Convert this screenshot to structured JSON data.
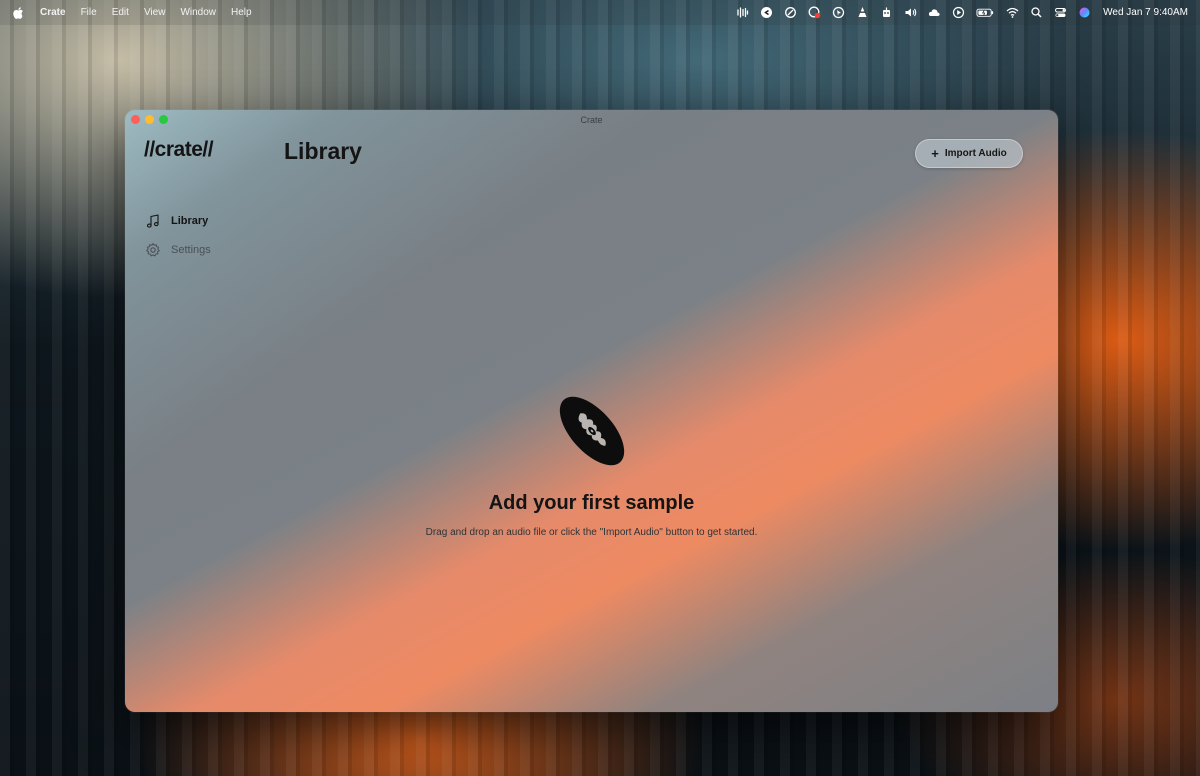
{
  "menubar": {
    "app_name": "Crate",
    "menus": [
      "File",
      "Edit",
      "View",
      "Window",
      "Help"
    ],
    "status_icons": [
      "waveform-icon",
      "clipboard-app-icon",
      "sync-icon",
      "recording-icon",
      "cursor-app-icon",
      "cone-icon",
      "robot-icon",
      "volume-icon",
      "cloud-icon",
      "play-icon",
      "battery-icon",
      "wifi-icon",
      "search-icon",
      "control-center-icon",
      "siri-icon"
    ],
    "clock": "Wed Jan 7  9:40AM"
  },
  "window": {
    "title": "Crate",
    "logo": "//crate//",
    "page_title": "Library",
    "import_button": {
      "icon": "plus-icon",
      "label": "Import Audio"
    }
  },
  "sidebar": {
    "items": [
      {
        "label": "Library",
        "icon": "music-note-icon",
        "active": true
      },
      {
        "label": "Settings",
        "icon": "gear-icon",
        "active": false
      }
    ]
  },
  "empty_state": {
    "icon": "vinyl-record-icon",
    "title": "Add your first sample",
    "subtitle": "Drag and drop an audio file or click the \"Import Audio\" button to get started."
  },
  "colors": {
    "accent_orange": "#ee8a62",
    "window_gray": "#7b8186",
    "text_dark": "#141414"
  }
}
